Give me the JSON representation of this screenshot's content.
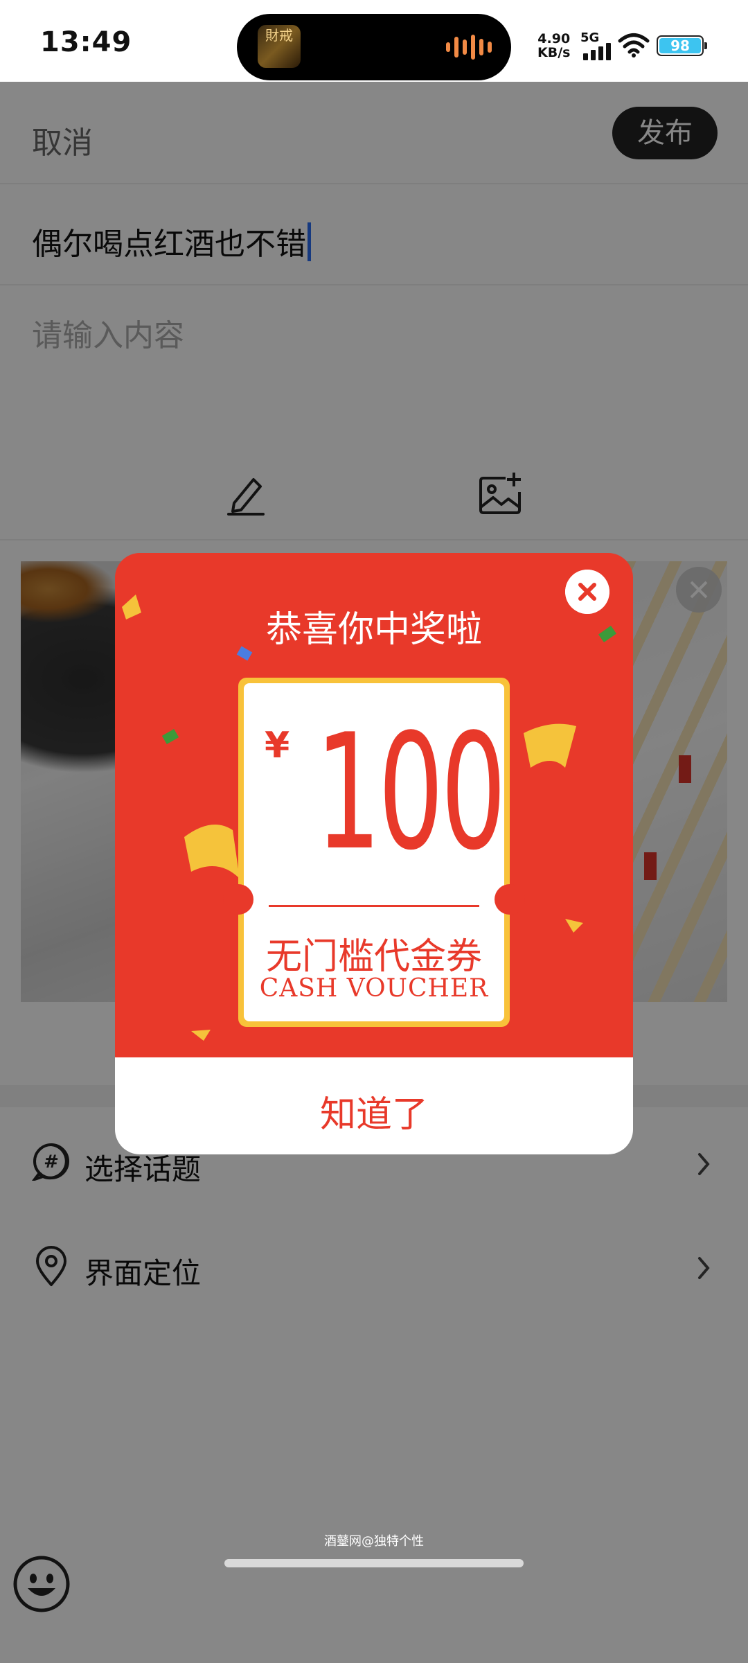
{
  "status_bar": {
    "time": "13:49",
    "island_app_text": "財戒",
    "net_speed": "4.90",
    "net_unit": "KB/s",
    "network": "5G",
    "battery": "98"
  },
  "header": {
    "cancel_label": "取消",
    "publish_label": "发布"
  },
  "post": {
    "title_value": "偶尔喝点红酒也不错",
    "content_placeholder": "请输入内容"
  },
  "options": {
    "topic_label": "选择话题",
    "location_label": "界面定位"
  },
  "dialog": {
    "title": "恭喜你中奖啦",
    "currency": "¥",
    "amount": "100",
    "voucher_title": "无门槛代金券",
    "voucher_subtitle": "CASH VOUCHER",
    "confirm_label": "知道了"
  },
  "watermark": "酒鼞网@独特个性",
  "colors": {
    "dialog_red": "#e8392a",
    "ticket_gold": "#f8c23a",
    "publish_bg": "#222222",
    "caret_blue": "#2a6cf0"
  },
  "icons": [
    "edit-icon",
    "add-image-icon",
    "photo-remove-icon",
    "topic-hash-icon",
    "location-pin-icon",
    "chevron-right-icon",
    "emoji-icon",
    "close-icon",
    "wifi-icon",
    "signal-icon",
    "battery-icon"
  ]
}
